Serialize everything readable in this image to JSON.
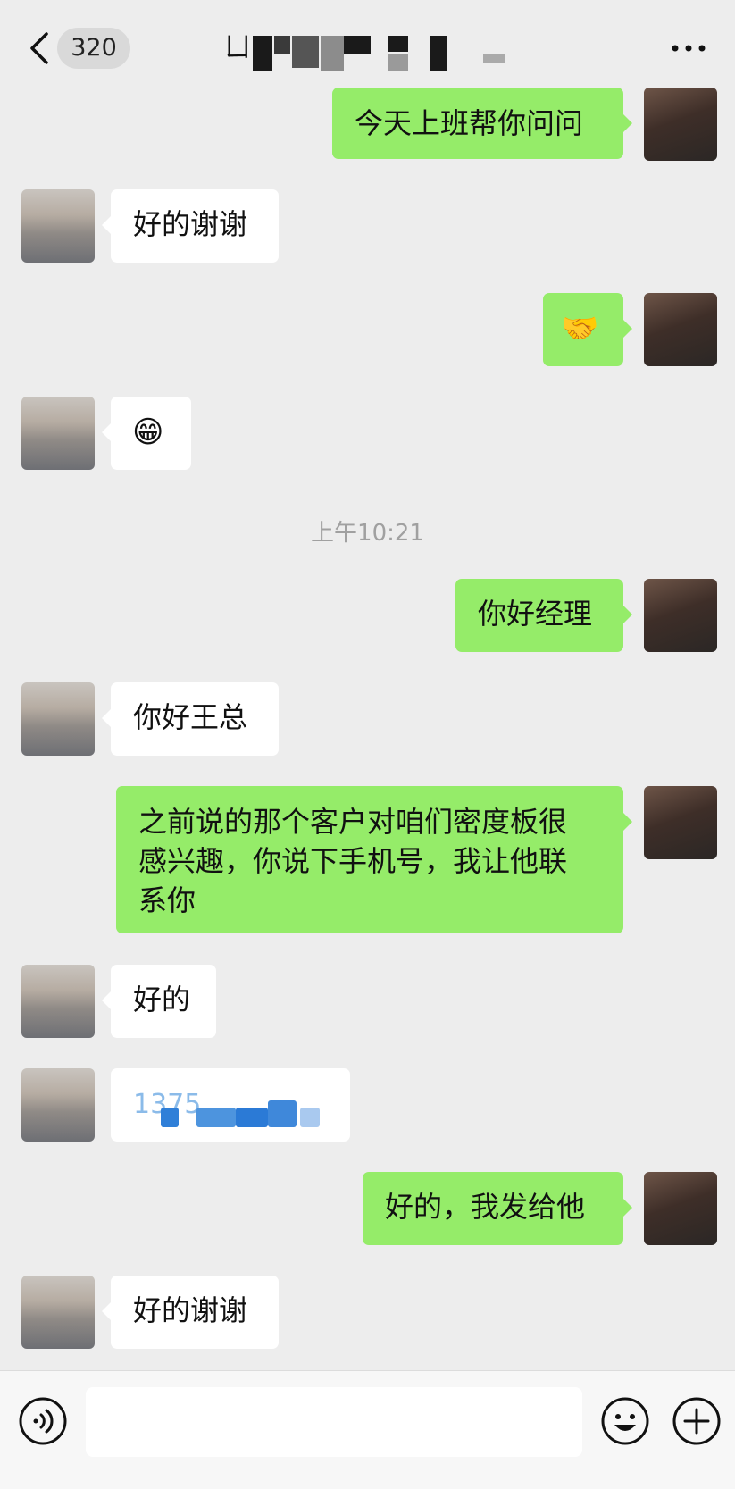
{
  "header": {
    "back_icon": "chevron-left-icon",
    "unread_count": "320",
    "title_visible_char": "ㄩ",
    "more_icon": "ellipsis-icon"
  },
  "messages": [
    {
      "side": "right",
      "text": "今天上班帮你问问"
    },
    {
      "side": "left",
      "text": "好的谢谢"
    },
    {
      "side": "right",
      "emoji": "🤝",
      "icon": "handshake-emoji-icon"
    },
    {
      "side": "left",
      "emoji": "😁",
      "icon": "grin-emoji-icon"
    },
    {
      "timestamp": "上午10:21"
    },
    {
      "side": "right",
      "text": "你好经理"
    },
    {
      "side": "left",
      "text": "你好王总"
    },
    {
      "side": "right",
      "lines": [
        "之前说的那个客户对咱们密度板很",
        "感兴趣，你说下手机号，我让他联",
        "系你"
      ]
    },
    {
      "side": "left",
      "text": "好的"
    },
    {
      "side": "left",
      "redacted": true,
      "partial_text": "1375"
    },
    {
      "side": "right",
      "text": "好的，我发给他"
    },
    {
      "side": "left",
      "text": "好的谢谢"
    }
  ],
  "input_bar": {
    "voice_icon": "voice-icon",
    "emoji_icon": "emoji-icon",
    "plus_icon": "plus-circle-icon",
    "text_value": ""
  },
  "colors": {
    "background": "#ededed",
    "bubble_me": "#95ec69",
    "bubble_other": "#ffffff",
    "timestamp": "#a0a0a0"
  }
}
